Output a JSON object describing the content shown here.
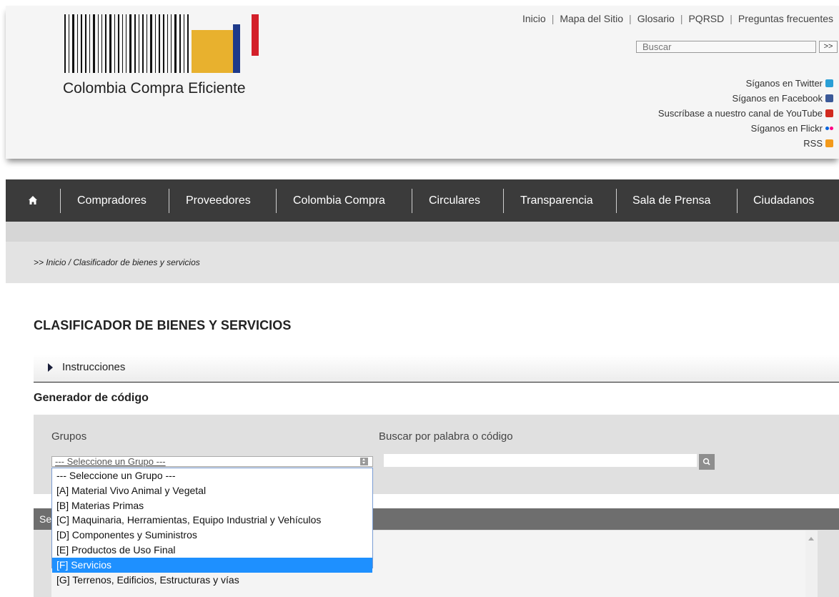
{
  "header": {
    "logo_text": "Colombia Compra Eficiente",
    "top_links": [
      "Inicio",
      "Mapa del Sitio",
      "Glosario",
      "PQRSD",
      "Preguntas frecuentes"
    ],
    "search_placeholder": "Buscar",
    "search_button": ">>",
    "social": [
      {
        "label": "Síganos en Twitter",
        "icon": "twitter-icon"
      },
      {
        "label": "Síganos en Facebook",
        "icon": "facebook-icon"
      },
      {
        "label": "Suscríbase a nuestro canal de YouTube",
        "icon": "youtube-icon"
      },
      {
        "label": "Síganos en Flickr",
        "icon": "flickr-icon"
      },
      {
        "label": "RSS",
        "icon": "rss-icon"
      }
    ]
  },
  "nav": {
    "home_icon": "home-icon",
    "items": [
      "Compradores",
      "Proveedores",
      "Colombia Compra",
      "Circulares",
      "Transparencia",
      "Sala de Prensa",
      "Ciudadanos"
    ]
  },
  "breadcrumb": ">> Inicio / Clasificador de bienes y servicios",
  "page_title": "CLASIFICADOR DE BIENES Y SERVICIOS",
  "instructions_label": "Instrucciones",
  "generator": {
    "title": "Generador de código",
    "groups_label": "Grupos",
    "search_label": "Buscar por palabra o código",
    "select_value": "--- Seleccione un Grupo ---",
    "search_value": "",
    "options": [
      "--- Seleccione un Grupo ---",
      "[A] Material Vivo Animal y Vegetal",
      "[B] Materias Primas",
      "[C] Maquinaria, Herramientas, Equipo Industrial y Vehículos",
      "[D] Componentes y Suministros",
      "[E] Productos de Uso Final",
      "[F] Servicios",
      "[G] Terrenos, Edificios, Estructuras y vías"
    ],
    "highlighted_option": "[F] Servicios"
  },
  "results_header": "Se",
  "colors": {
    "nav_bg": "#3b3b3b",
    "highlight": "#1e90ff",
    "logo_yellow": "#e8b12e",
    "logo_red": "#d3202a",
    "logo_blue": "#1e3a8a"
  }
}
